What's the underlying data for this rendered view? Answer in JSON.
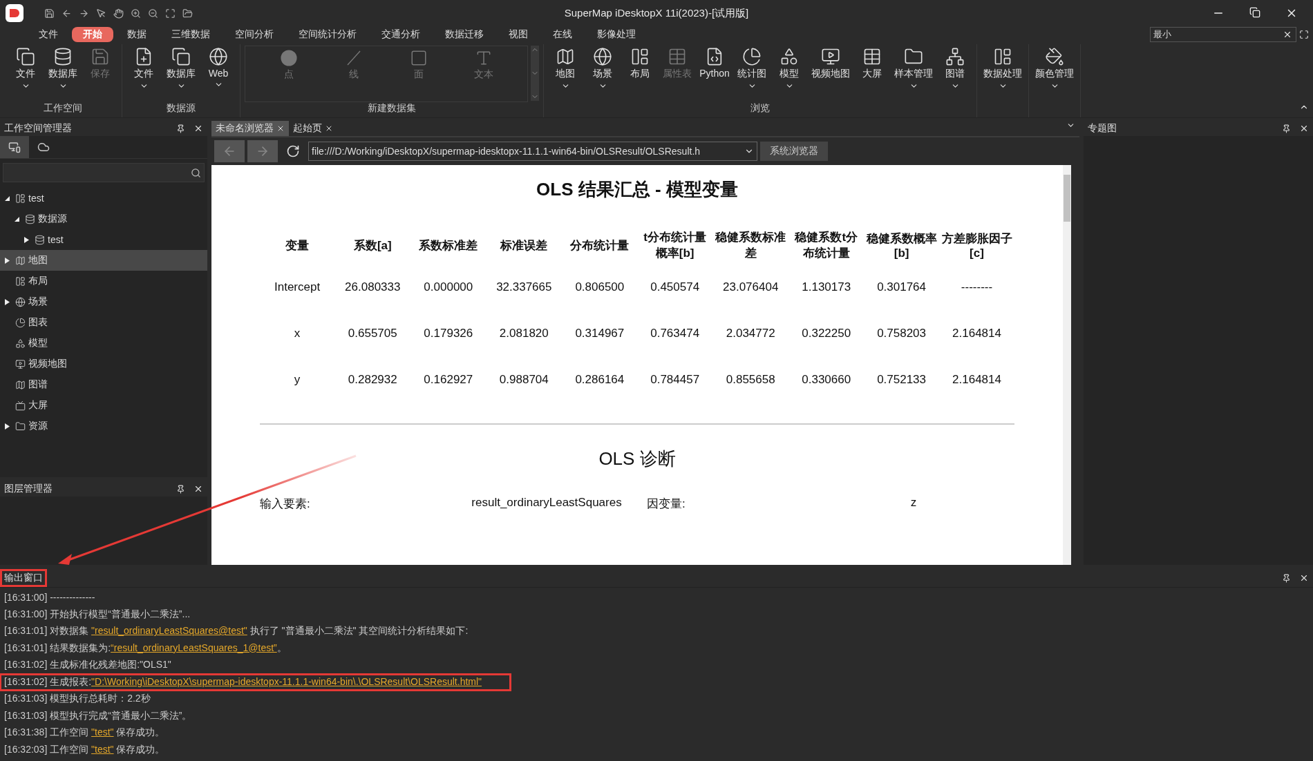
{
  "window": {
    "title": "SuperMap iDesktopX 11i(2023)-[试用版]"
  },
  "menu_tabs": [
    {
      "label": "文件",
      "selected": false
    },
    {
      "label": "开始",
      "selected": true
    },
    {
      "label": "数据",
      "selected": false
    },
    {
      "label": "三维数据",
      "selected": false
    },
    {
      "label": "空间分析",
      "selected": false
    },
    {
      "label": "空间统计分析",
      "selected": false
    },
    {
      "label": "交通分析",
      "selected": false
    },
    {
      "label": "数据迁移",
      "selected": false
    },
    {
      "label": "视图",
      "selected": false
    },
    {
      "label": "在线",
      "selected": false
    },
    {
      "label": "影像处理",
      "selected": false
    }
  ],
  "search": {
    "value": "最小"
  },
  "ribbon_groups": [
    {
      "label": "工作空间",
      "kind": "buttons",
      "items": [
        {
          "label": "文件",
          "dropdown": true,
          "disabled": false
        },
        {
          "label": "数据库",
          "dropdown": true,
          "disabled": false
        },
        {
          "label": "保存",
          "dropdown": false,
          "disabled": true
        }
      ]
    },
    {
      "label": "数据源",
      "kind": "buttons",
      "items": [
        {
          "label": "文件",
          "dropdown": true,
          "disabled": false
        },
        {
          "label": "数据库",
          "dropdown": true,
          "disabled": false
        },
        {
          "label": "Web",
          "dropdown": true,
          "disabled": false
        }
      ]
    },
    {
      "label": "新建数据集",
      "kind": "gallery",
      "items": [
        {
          "label": "点",
          "dropdown": false,
          "disabled": true
        },
        {
          "label": "线",
          "dropdown": false,
          "disabled": true
        },
        {
          "label": "面",
          "dropdown": false,
          "disabled": true
        },
        {
          "label": "文本",
          "dropdown": false,
          "disabled": true
        }
      ]
    },
    {
      "label": "浏览",
      "kind": "buttons",
      "items": [
        {
          "label": "地图",
          "dropdown": true,
          "disabled": false
        },
        {
          "label": "场景",
          "dropdown": true,
          "disabled": false
        },
        {
          "label": "布局",
          "dropdown": false,
          "disabled": false
        },
        {
          "label": "属性表",
          "dropdown": false,
          "disabled": true
        },
        {
          "label": "Python",
          "dropdown": false,
          "disabled": false
        },
        {
          "label": "统计图",
          "dropdown": true,
          "disabled": false
        },
        {
          "label": "模型",
          "dropdown": true,
          "disabled": false
        },
        {
          "label": "视频地图",
          "dropdown": false,
          "disabled": false
        },
        {
          "label": "大屏",
          "dropdown": false,
          "disabled": false
        },
        {
          "label": "样本管理",
          "dropdown": true,
          "disabled": false
        },
        {
          "label": "图谱",
          "dropdown": true,
          "disabled": false
        }
      ]
    },
    {
      "kind": "buttons",
      "items": [
        {
          "label": "数据处理",
          "dropdown": true,
          "disabled": false
        }
      ]
    },
    {
      "kind": "buttons",
      "items": [
        {
          "label": "颜色管理",
          "dropdown": true,
          "disabled": false
        }
      ]
    }
  ],
  "workspace_panel": {
    "title": "工作空间管理器",
    "tree": [
      {
        "label": "test",
        "expanded": true,
        "selected": false,
        "children": [
          {
            "label": "数据源",
            "expanded": true,
            "selected": false,
            "children": [
              {
                "label": "test",
                "expanded": false,
                "selected": false
              }
            ]
          }
        ]
      },
      {
        "label": "地图",
        "expanded": false,
        "selected": true
      },
      {
        "label": "布局",
        "selected": false
      },
      {
        "label": "场景",
        "expanded": false,
        "selected": false
      },
      {
        "label": "图表",
        "selected": false
      },
      {
        "label": "模型",
        "selected": false
      },
      {
        "label": "视频地图",
        "selected": false
      },
      {
        "label": "图谱",
        "selected": false
      },
      {
        "label": "大屏",
        "selected": false
      },
      {
        "label": "资源",
        "expanded": false,
        "selected": false
      }
    ]
  },
  "layer_panel": {
    "title": "图层管理器"
  },
  "document_tabs": [
    {
      "label": "未命名浏览器",
      "selected": true
    },
    {
      "label": "起始页",
      "selected": false
    }
  ],
  "address": {
    "value": "file:///D:/Working/iDesktopX/supermap-idesktopx-11.1.1-win64-bin/OLSResult/OLSResult.h"
  },
  "system_browser_button": "系统浏览器",
  "report": {
    "title": "OLS 结果汇总 - 模型变量",
    "columns": [
      "变量",
      "系数[a]",
      "系数标准差",
      "标准误差",
      "分布统计量",
      "t分布统计量概率[b]",
      "稳健系数标准差",
      "稳健系数t分布统计量",
      "稳健系数概率[b]",
      "方差膨胀因子[c]"
    ],
    "rows": [
      [
        "Intercept",
        "26.080333",
        "0.000000",
        "32.337665",
        "0.806500",
        "0.450574",
        "23.076404",
        "1.130173",
        "0.301764",
        "--------"
      ],
      [
        "x",
        "0.655705",
        "0.179326",
        "2.081820",
        "0.314967",
        "0.763474",
        "2.034772",
        "0.322250",
        "0.758203",
        "2.164814"
      ],
      [
        "y",
        "0.282932",
        "0.162927",
        "0.988704",
        "0.286164",
        "0.784457",
        "0.855658",
        "0.330660",
        "0.752133",
        "2.164814"
      ]
    ],
    "diagnostics_title": "OLS 诊断",
    "diagnostics": [
      {
        "label": "输入要素:",
        "value": "result_ordinaryLeastSquares"
      },
      {
        "label": "因变量:",
        "value": "z"
      }
    ]
  },
  "right_panel": {
    "title": "专题图"
  },
  "output": {
    "title": "输出窗口",
    "highlighted": true,
    "lines": [
      {
        "time": "[16:31:00]",
        "highlighted": false,
        "parts": [
          {
            "text": " --------------",
            "link": false
          }
        ]
      },
      {
        "time": "[16:31:00]",
        "highlighted": false,
        "parts": [
          {
            "text": " 开始执行模型“普通最小二乘法”...",
            "link": false
          }
        ]
      },
      {
        "time": "[16:31:01]",
        "highlighted": false,
        "parts": [
          {
            "text": " 对数据集 ",
            "link": false
          },
          {
            "text": "\"result_ordinaryLeastSquares@test\"",
            "link": true
          },
          {
            "text": " 执行了 \"普通最小二乘法\" 其空间统计分析结果如下:",
            "link": false
          }
        ]
      },
      {
        "time": "[16:31:01]",
        "highlighted": false,
        "parts": [
          {
            "text": " 结果数据集为:",
            "link": false
          },
          {
            "text": "“result_ordinaryLeastSquares_1@test”",
            "link": true
          },
          {
            "text": "。",
            "link": false
          }
        ]
      },
      {
        "time": "[16:31:02]",
        "highlighted": false,
        "parts": [
          {
            "text": " 生成标准化残差地图:\"OLS1\"",
            "link": false
          }
        ]
      },
      {
        "time": "[16:31:02]",
        "highlighted": true,
        "parts": [
          {
            "text": " 生成报表:",
            "link": false
          },
          {
            "text": "\"D:\\Working\\iDesktopX\\supermap-idesktopx-11.1.1-win64-bin\\.\\OLSResult\\OLSResult.html\"",
            "link": true
          }
        ]
      },
      {
        "time": "[16:31:03]",
        "highlighted": false,
        "parts": [
          {
            "text": " 模型执行总耗时：2.2秒",
            "link": false
          }
        ]
      },
      {
        "time": "[16:31:03]",
        "highlighted": false,
        "parts": [
          {
            "text": " 模型执行完成“普通最小二乘法”。",
            "link": false
          }
        ]
      },
      {
        "time": "[16:31:38]",
        "highlighted": false,
        "parts": [
          {
            "text": " 工作空间 ",
            "link": false
          },
          {
            "text": "\"test\"",
            "link": true
          },
          {
            "text": " 保存成功。",
            "link": false
          }
        ]
      },
      {
        "time": "[16:32:03]",
        "highlighted": false,
        "parts": [
          {
            "text": " 工作空间 ",
            "link": false
          },
          {
            "text": "\"test\"",
            "link": true
          },
          {
            "text": " 保存成功。",
            "link": false
          }
        ]
      }
    ]
  }
}
